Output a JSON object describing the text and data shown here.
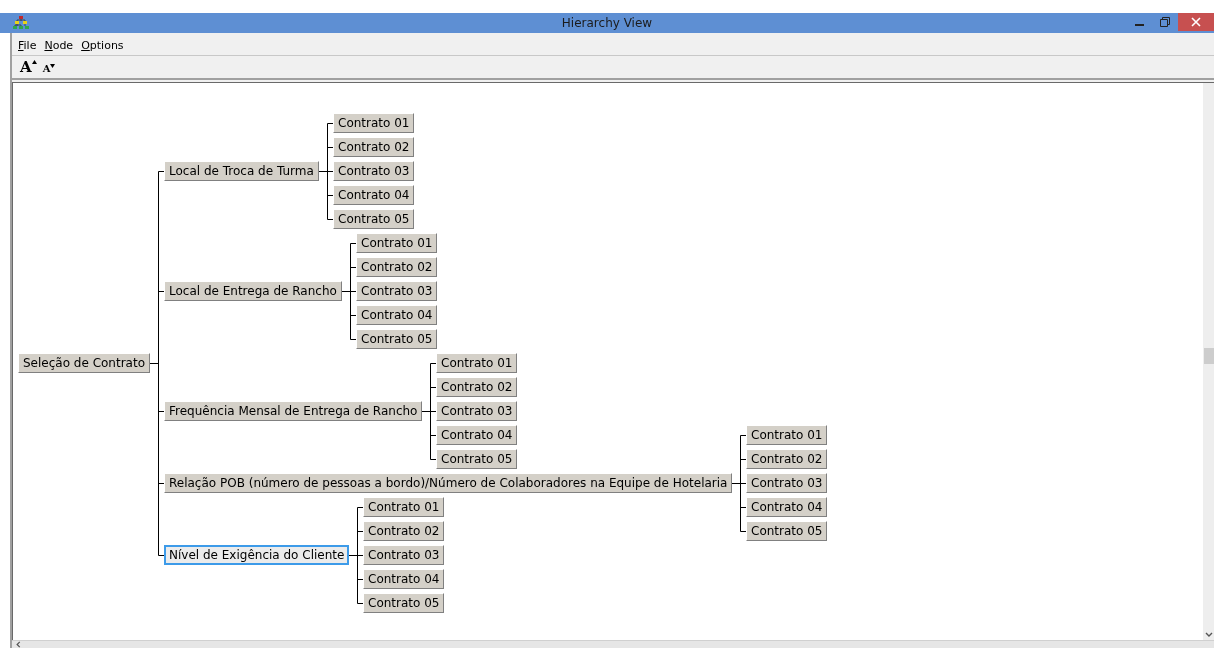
{
  "window": {
    "title": "Hierarchy View"
  },
  "menu": [
    {
      "label": "File"
    },
    {
      "label": "Node"
    },
    {
      "label": "Options"
    }
  ],
  "toolbar": [
    {
      "label": "A",
      "kind": "grow"
    },
    {
      "label": "A",
      "kind": "shrink"
    }
  ],
  "tree": {
    "label": "Seleção de Contrato",
    "selected": false,
    "children": [
      {
        "label": "Local de Troca de Turma",
        "selected": false,
        "children": [
          {
            "label": "Contrato 01",
            "selected": false
          },
          {
            "label": "Contrato 02",
            "selected": false
          },
          {
            "label": "Contrato 03",
            "selected": false
          },
          {
            "label": "Contrato 04",
            "selected": false
          },
          {
            "label": "Contrato 05",
            "selected": false
          }
        ]
      },
      {
        "label": "Local de Entrega de Rancho",
        "selected": false,
        "children": [
          {
            "label": "Contrato 01",
            "selected": false
          },
          {
            "label": "Contrato 02",
            "selected": false
          },
          {
            "label": "Contrato 03",
            "selected": false
          },
          {
            "label": "Contrato 04",
            "selected": false
          },
          {
            "label": "Contrato 05",
            "selected": false
          }
        ]
      },
      {
        "label": "Frequência Mensal de Entrega de Rancho",
        "selected": false,
        "children": [
          {
            "label": "Contrato 01",
            "selected": false
          },
          {
            "label": "Contrato 02",
            "selected": false
          },
          {
            "label": "Contrato 03",
            "selected": false
          },
          {
            "label": "Contrato 04",
            "selected": false
          },
          {
            "label": "Contrato 05",
            "selected": false
          }
        ]
      },
      {
        "label": "Relação POB (número de pessoas a bordo)/Número de Colaboradores na Equipe de Hotelaria",
        "selected": false,
        "children": [
          {
            "label": "Contrato 01",
            "selected": false
          },
          {
            "label": "Contrato 02",
            "selected": false
          },
          {
            "label": "Contrato 03",
            "selected": false
          },
          {
            "label": "Contrato 04",
            "selected": false
          },
          {
            "label": "Contrato 05",
            "selected": false
          }
        ]
      },
      {
        "label": "Nível de Exigência do Cliente",
        "selected": true,
        "children": [
          {
            "label": "Contrato 01",
            "selected": false
          },
          {
            "label": "Contrato 02",
            "selected": false
          },
          {
            "label": "Contrato 03",
            "selected": false
          },
          {
            "label": "Contrato 04",
            "selected": false
          },
          {
            "label": "Contrato 05",
            "selected": false
          }
        ]
      }
    ]
  }
}
